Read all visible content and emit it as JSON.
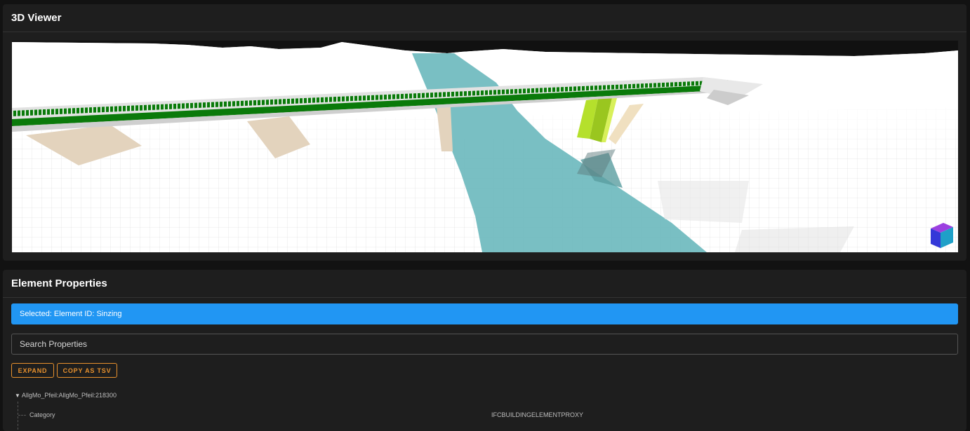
{
  "viewer": {
    "title": "3D Viewer"
  },
  "properties": {
    "title": "Element Properties",
    "selected_text": "Selected: Element ID: Sinzing",
    "search_placeholder": "Search Properties",
    "expand_label": "EXPAND",
    "copy_label": "COPY AS TSV",
    "tree": {
      "root_label": "AllgMo_Pfeil:AllgMo_Pfeil:218300",
      "rows": [
        {
          "key": "Category",
          "value": "IFCBUILDINGELEMENTPROXY"
        }
      ]
    }
  },
  "colors": {
    "accent": "#2196f3",
    "button_outline": "#e8912d",
    "panel_bg": "#1e1e1e",
    "page_bg": "#121212",
    "river": "#72bcc0",
    "deck_green": "#0a7a0a",
    "pier": "#e3d3bd",
    "highlight_pier": "#b5e02c"
  },
  "icons": {
    "nav_cube": "view-cube-icon",
    "tree_caret": "caret-down-icon"
  }
}
